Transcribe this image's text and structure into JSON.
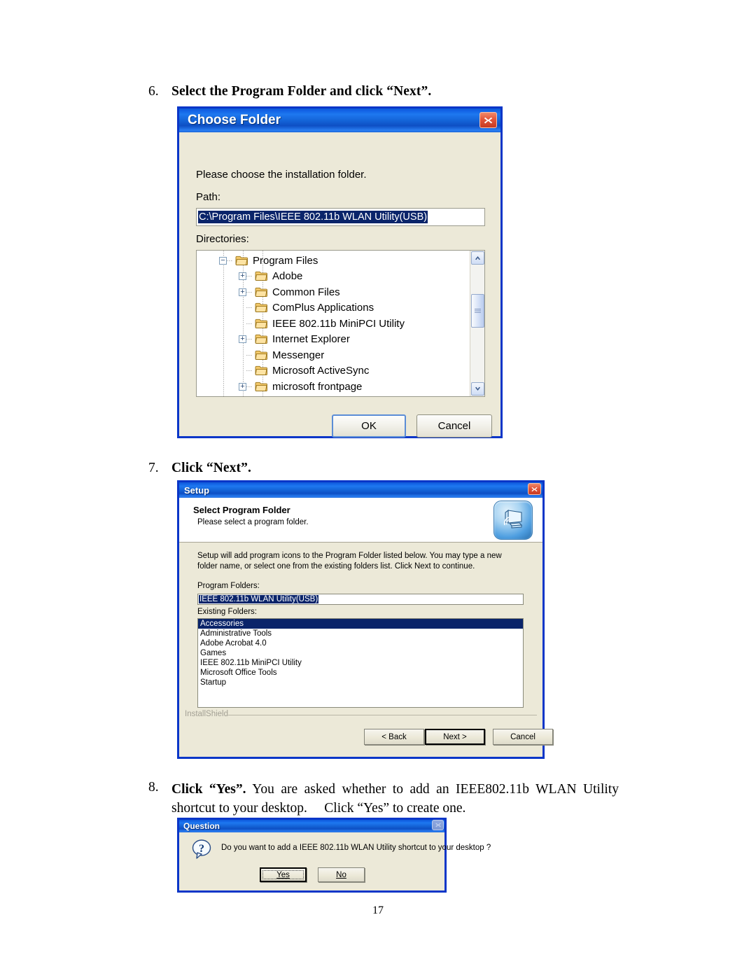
{
  "page": {
    "number": "17"
  },
  "steps": {
    "six": {
      "number": "6.",
      "text": "Select the Program Folder and click “Next”."
    },
    "seven": {
      "number": "7.",
      "text": "Click “Next”."
    },
    "eight": {
      "number": "8.",
      "bold": "Click “Yes”.",
      "rest": " You are asked whether to add an IEEE802.11b WLAN Utility shortcut to your desktop.  Click “Yes” to create one."
    }
  },
  "choose_folder_dialog": {
    "title": "Choose Folder",
    "close_label": "✕",
    "prompt": "Please choose the installation folder.",
    "path_label": "Path:",
    "path_value": "C:\\Program Files\\IEEE 802.11b WLAN Utility(USB)",
    "directories_label": "Directories:",
    "tree": [
      {
        "label": "Program Files",
        "depth": 0,
        "expander": "minus"
      },
      {
        "label": "Adobe",
        "depth": 1,
        "expander": "plus"
      },
      {
        "label": "Common Files",
        "depth": 1,
        "expander": "plus"
      },
      {
        "label": "ComPlus Applications",
        "depth": 1,
        "expander": "none"
      },
      {
        "label": "IEEE 802.11b MiniPCI Utility",
        "depth": 1,
        "expander": "none"
      },
      {
        "label": "Internet Explorer",
        "depth": 1,
        "expander": "plus"
      },
      {
        "label": "Messenger",
        "depth": 1,
        "expander": "none"
      },
      {
        "label": "Microsoft ActiveSync",
        "depth": 1,
        "expander": "none"
      },
      {
        "label": "microsoft frontpage",
        "depth": 1,
        "expander": "plus"
      }
    ],
    "scrollbar": {
      "up_icon": "chevron-up",
      "down_icon": "chevron-down"
    },
    "ok_label": "OK",
    "cancel_label": "Cancel"
  },
  "setup_dialog": {
    "title": "Setup",
    "close_label": "✕",
    "header_title": "Select Program Folder",
    "header_subtitle": "Please select a program folder.",
    "icon_name": "computer-install-icon",
    "body_text": "Setup will add program icons to the Program Folder listed below.  You may type a new folder name, or select one from the existing folders list.  Click Next to continue.",
    "program_folders_label": "Program Folders:",
    "program_folders_value": "IEEE 802.11b WLAN Utility(USB)",
    "existing_folders_label": "Existing Folders:",
    "existing_folders": [
      "Accessories",
      "Administrative Tools",
      "Adobe Acrobat 4.0",
      "Games",
      "IEEE 802.11b MiniPCI Utility",
      "Microsoft Office Tools",
      "Startup"
    ],
    "selected_folder_index": 0,
    "brand": "InstallShield",
    "back_label": "< Back",
    "next_label": "Next >",
    "cancel_label": "Cancel"
  },
  "question_dialog": {
    "title": "Question",
    "close_label": "✕",
    "icon_name": "question-bubble-icon",
    "message": "Do you want to add a IEEE 802.11b WLAN Utility shortcut to your desktop ?",
    "yes_label": "Yes",
    "no_label": "No"
  },
  "colors": {
    "title_blue": "#1464d8",
    "frame_blue": "#0a36c8",
    "dialog_face": "#ece9d8",
    "selection_blue": "#0a246a",
    "close_red": "#e2563a"
  }
}
